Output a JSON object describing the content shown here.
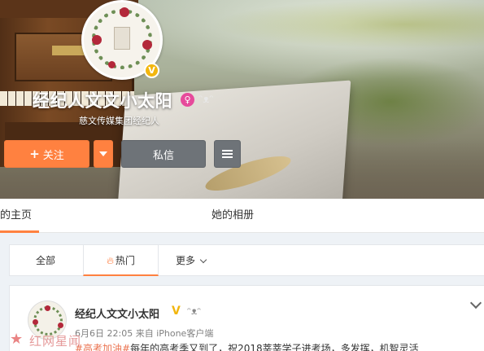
{
  "profile": {
    "name": "经纪人文文小太阳",
    "description": "慈文传媒集团经纪人",
    "verified_badge": "V",
    "gender_icon": "♀",
    "bot_icon": "ᵔᴥᵔ"
  },
  "actions": {
    "follow_label": "关注",
    "message_label": "私信"
  },
  "profile_tabs": {
    "home": "的主页",
    "album": "她的相册"
  },
  "filter_tabs": {
    "all": "全部",
    "hot": "热门",
    "more": "更多"
  },
  "post": {
    "author": "经纪人文文小太阳",
    "verified": "V",
    "date": "6月6日 22:05",
    "source": "来自 iPhone客户端",
    "hashtag": "#高考加油#",
    "text": "每年的高考季又到了，祝2018莘莘学子进考场，多发挥，机智灵活"
  },
  "watermark": "红网星闻",
  "colors": {
    "accent": "#ff8140",
    "verified": "#f2b60f",
    "secondary_button": "#6e7378"
  }
}
